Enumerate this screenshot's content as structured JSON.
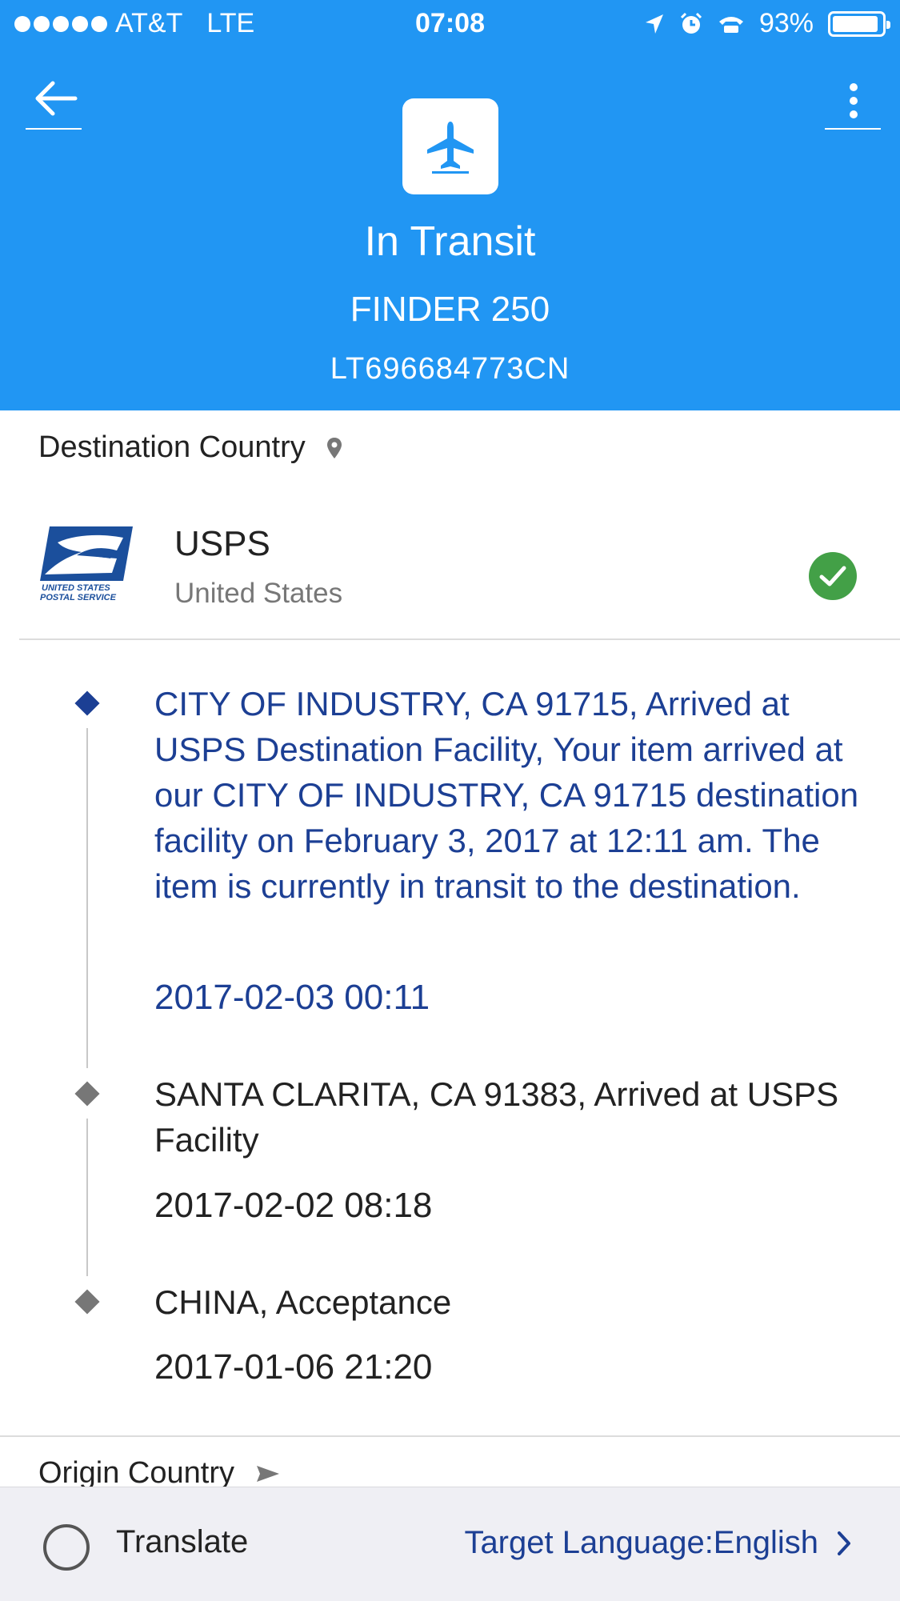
{
  "status_bar": {
    "carrier": "AT&T",
    "network": "LTE",
    "time": "07:08",
    "battery": "93%",
    "battery_level": 0.93
  },
  "header": {
    "status": "In Transit",
    "package_name": "FINDER 250",
    "tracking_number": "LT696684773CN",
    "background_color": "#2196f3"
  },
  "destination": {
    "label": "Destination Country",
    "carrier_name": "USPS",
    "carrier_country": "United States",
    "logo_text_line1": "UNITED STATES",
    "logo_text_line2": "POSTAL SERVICE"
  },
  "events": [
    {
      "description": "CITY OF INDUSTRY, CA 91715, Arrived at USPS Destination Facility, Your item arrived at our CITY OF INDUSTRY, CA 91715 destination facility on February 3, 2017 at 12:11 am. The item is currently in transit to the destination.",
      "time": "2017-02-03 00:11",
      "active": true
    },
    {
      "description": "SANTA CLARITA, CA 91383, Arrived at USPS Facility",
      "time": "2017-02-02 08:18",
      "active": false
    },
    {
      "description": "CHINA, Acceptance",
      "time": "2017-01-06 21:20",
      "active": false
    }
  ],
  "origin": {
    "label": "Origin Country"
  },
  "bottom_bar": {
    "translate_label": "Translate",
    "target_language": "Target Language:English"
  },
  "icons": {
    "back": "back-arrow-icon",
    "menu": "more-vertical-icon",
    "status": "airplane-icon",
    "location": "location-pin-icon",
    "verified": "checkmark-icon",
    "origin": "send-arrow-icon",
    "chevron": "chevron-right-icon"
  },
  "colors": {
    "accent": "#2196f3",
    "active_event": "#1c3f94",
    "success": "#43a047"
  }
}
